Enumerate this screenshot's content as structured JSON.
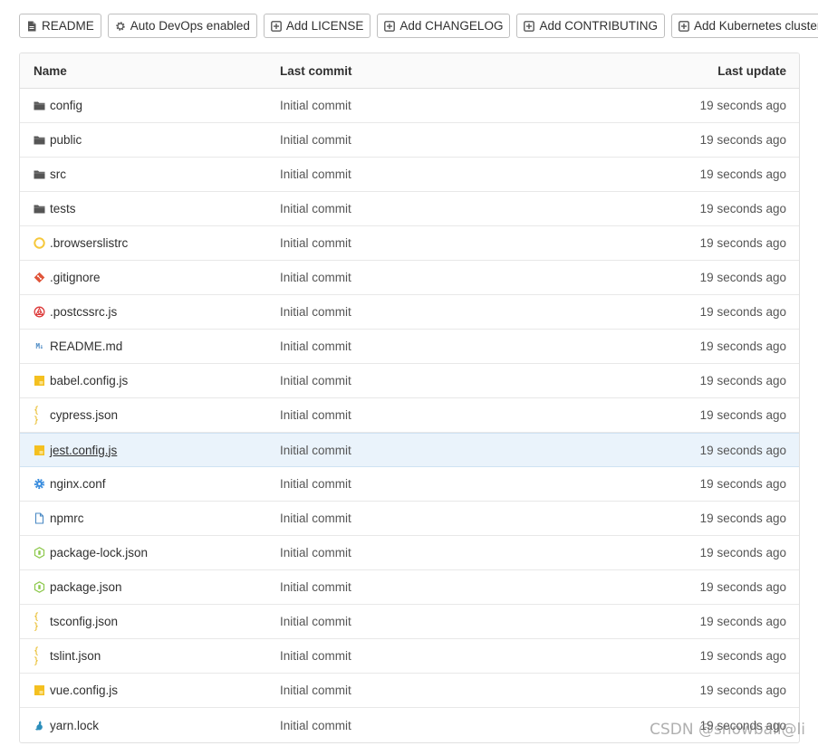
{
  "toolbar": {
    "buttons": [
      {
        "label": "README",
        "icon": "file-icon"
      },
      {
        "label": "Auto DevOps enabled",
        "icon": "gear-icon"
      },
      {
        "label": "Add LICENSE",
        "icon": "plus-square-icon"
      },
      {
        "label": "Add CHANGELOG",
        "icon": "plus-square-icon"
      },
      {
        "label": "Add CONTRIBUTING",
        "icon": "plus-square-icon"
      },
      {
        "label": "Add Kubernetes cluster",
        "icon": "plus-square-icon"
      }
    ]
  },
  "table": {
    "headers": {
      "name": "Name",
      "last_commit": "Last commit",
      "last_update": "Last update"
    },
    "rows": [
      {
        "name": "config",
        "icon": "folder-icon",
        "commit": "Initial commit",
        "updated": "19 seconds ago"
      },
      {
        "name": "public",
        "icon": "folder-icon",
        "commit": "Initial commit",
        "updated": "19 seconds ago"
      },
      {
        "name": "src",
        "icon": "folder-icon",
        "commit": "Initial commit",
        "updated": "19 seconds ago"
      },
      {
        "name": "tests",
        "icon": "folder-icon",
        "commit": "Initial commit",
        "updated": "19 seconds ago"
      },
      {
        "name": ".browserslistrc",
        "icon": "browserslist-icon",
        "commit": "Initial commit",
        "updated": "19 seconds ago"
      },
      {
        "name": ".gitignore",
        "icon": "git-icon",
        "commit": "Initial commit",
        "updated": "19 seconds ago"
      },
      {
        "name": ".postcssrc.js",
        "icon": "postcss-icon",
        "commit": "Initial commit",
        "updated": "19 seconds ago"
      },
      {
        "name": "README.md",
        "icon": "markdown-icon",
        "commit": "Initial commit",
        "updated": "19 seconds ago"
      },
      {
        "name": "babel.config.js",
        "icon": "javascript-icon",
        "commit": "Initial commit",
        "updated": "19 seconds ago"
      },
      {
        "name": "cypress.json",
        "icon": "json-icon",
        "commit": "Initial commit",
        "updated": "19 seconds ago"
      },
      {
        "name": "jest.config.js",
        "icon": "javascript-icon",
        "commit": "Initial commit",
        "updated": "19 seconds ago",
        "hover": true
      },
      {
        "name": "nginx.conf",
        "icon": "settings-gear-icon",
        "commit": "Initial commit",
        "updated": "19 seconds ago"
      },
      {
        "name": "npmrc",
        "icon": "file-outline-icon",
        "commit": "Initial commit",
        "updated": "19 seconds ago"
      },
      {
        "name": "package-lock.json",
        "icon": "nodejs-icon",
        "commit": "Initial commit",
        "updated": "19 seconds ago"
      },
      {
        "name": "package.json",
        "icon": "nodejs-icon",
        "commit": "Initial commit",
        "updated": "19 seconds ago"
      },
      {
        "name": "tsconfig.json",
        "icon": "json-icon",
        "commit": "Initial commit",
        "updated": "19 seconds ago"
      },
      {
        "name": "tslint.json",
        "icon": "json-icon",
        "commit": "Initial commit",
        "updated": "19 seconds ago"
      },
      {
        "name": "vue.config.js",
        "icon": "javascript-icon",
        "commit": "Initial commit",
        "updated": "19 seconds ago"
      },
      {
        "name": "yarn.lock",
        "icon": "yarn-icon",
        "commit": "Initial commit",
        "updated": "19 seconds ago"
      }
    ]
  },
  "watermark": "CSDN @snowball@li",
  "colors": {
    "border": "#e0e0e0",
    "hover_row": "#eaf3fb",
    "folder": "#555555",
    "json": "#e5b20a",
    "js": "#f4c020"
  }
}
